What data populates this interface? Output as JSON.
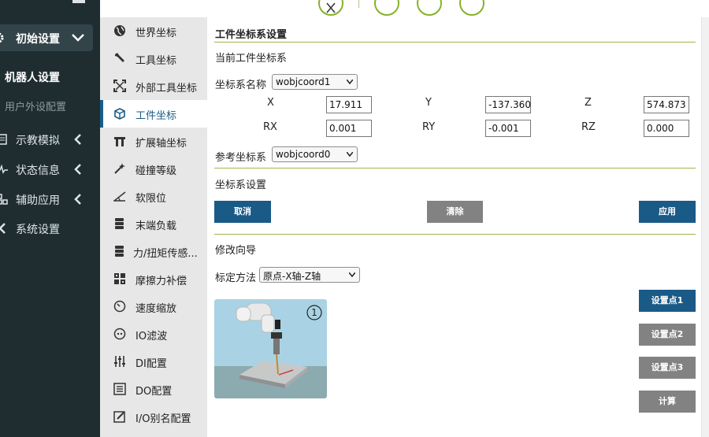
{
  "sidebar": {
    "group_label": "初始设置",
    "subitems": [
      "机器人设置",
      "用户外设配置"
    ],
    "items": [
      {
        "label": "示教模拟",
        "has_chevron": true
      },
      {
        "label": "状态信息",
        "has_chevron": true
      },
      {
        "label": "辅助应用",
        "has_chevron": true
      },
      {
        "label": "系统设置",
        "has_chevron": false
      }
    ]
  },
  "menu": {
    "items": [
      {
        "label": "世界坐标",
        "icon": "globe-icon"
      },
      {
        "label": "工具坐标",
        "icon": "wrench-icon"
      },
      {
        "label": "外部工具坐标",
        "icon": "expand-icon"
      },
      {
        "label": "工件坐标",
        "icon": "cube-icon",
        "active": true
      },
      {
        "label": "扩展轴坐标",
        "icon": "axis-icon"
      },
      {
        "label": "碰撞等级",
        "icon": "wand-icon"
      },
      {
        "label": "软限位",
        "icon": "angle-icon"
      },
      {
        "label": "末端负载",
        "icon": "stack-icon"
      },
      {
        "label": "力/扭矩传感...",
        "icon": "stack-icon"
      },
      {
        "label": "摩擦力补偿",
        "icon": "grid-icon"
      },
      {
        "label": "速度缩放",
        "icon": "gauge-icon"
      },
      {
        "label": "IO滤波",
        "icon": "filter-icon"
      },
      {
        "label": "DI配置",
        "icon": "sliders-icon"
      },
      {
        "label": "DO配置",
        "icon": "list-icon"
      },
      {
        "label": "I/O别名配置",
        "icon": "edit-icon"
      }
    ]
  },
  "main": {
    "title": "工件坐标系设置",
    "current_label": "当前工件坐标系",
    "coord_name_label": "坐标系名称",
    "coord_name_value": "wobjcoord1",
    "fields": {
      "x_label": "X",
      "x_value": "17.911",
      "y_label": "Y",
      "y_value": "-137.360",
      "z_label": "Z",
      "z_value": "574.873",
      "rx_label": "RX",
      "rx_value": "0.001",
      "ry_label": "RY",
      "ry_value": "-0.001",
      "rz_label": "RZ",
      "rz_value": "0.000"
    },
    "ref_label": "参考坐标系",
    "ref_value": "wobjcoord0",
    "settings_label": "坐标系设置",
    "buttons": {
      "cancel": "取消",
      "clear": "清除",
      "apply": "应用"
    },
    "wizard_label": "修改向导",
    "method_label": "标定方法",
    "method_value": "原点-X轴-Z轴",
    "step_badge": "1",
    "point_buttons": {
      "p1": "设置点1",
      "p2": "设置点2",
      "p3": "设置点3",
      "calc": "计算"
    }
  },
  "colors": {
    "accent": "#1a5a87",
    "divider": "#9bb84a",
    "sidebar_bg": "#1f2d31"
  }
}
